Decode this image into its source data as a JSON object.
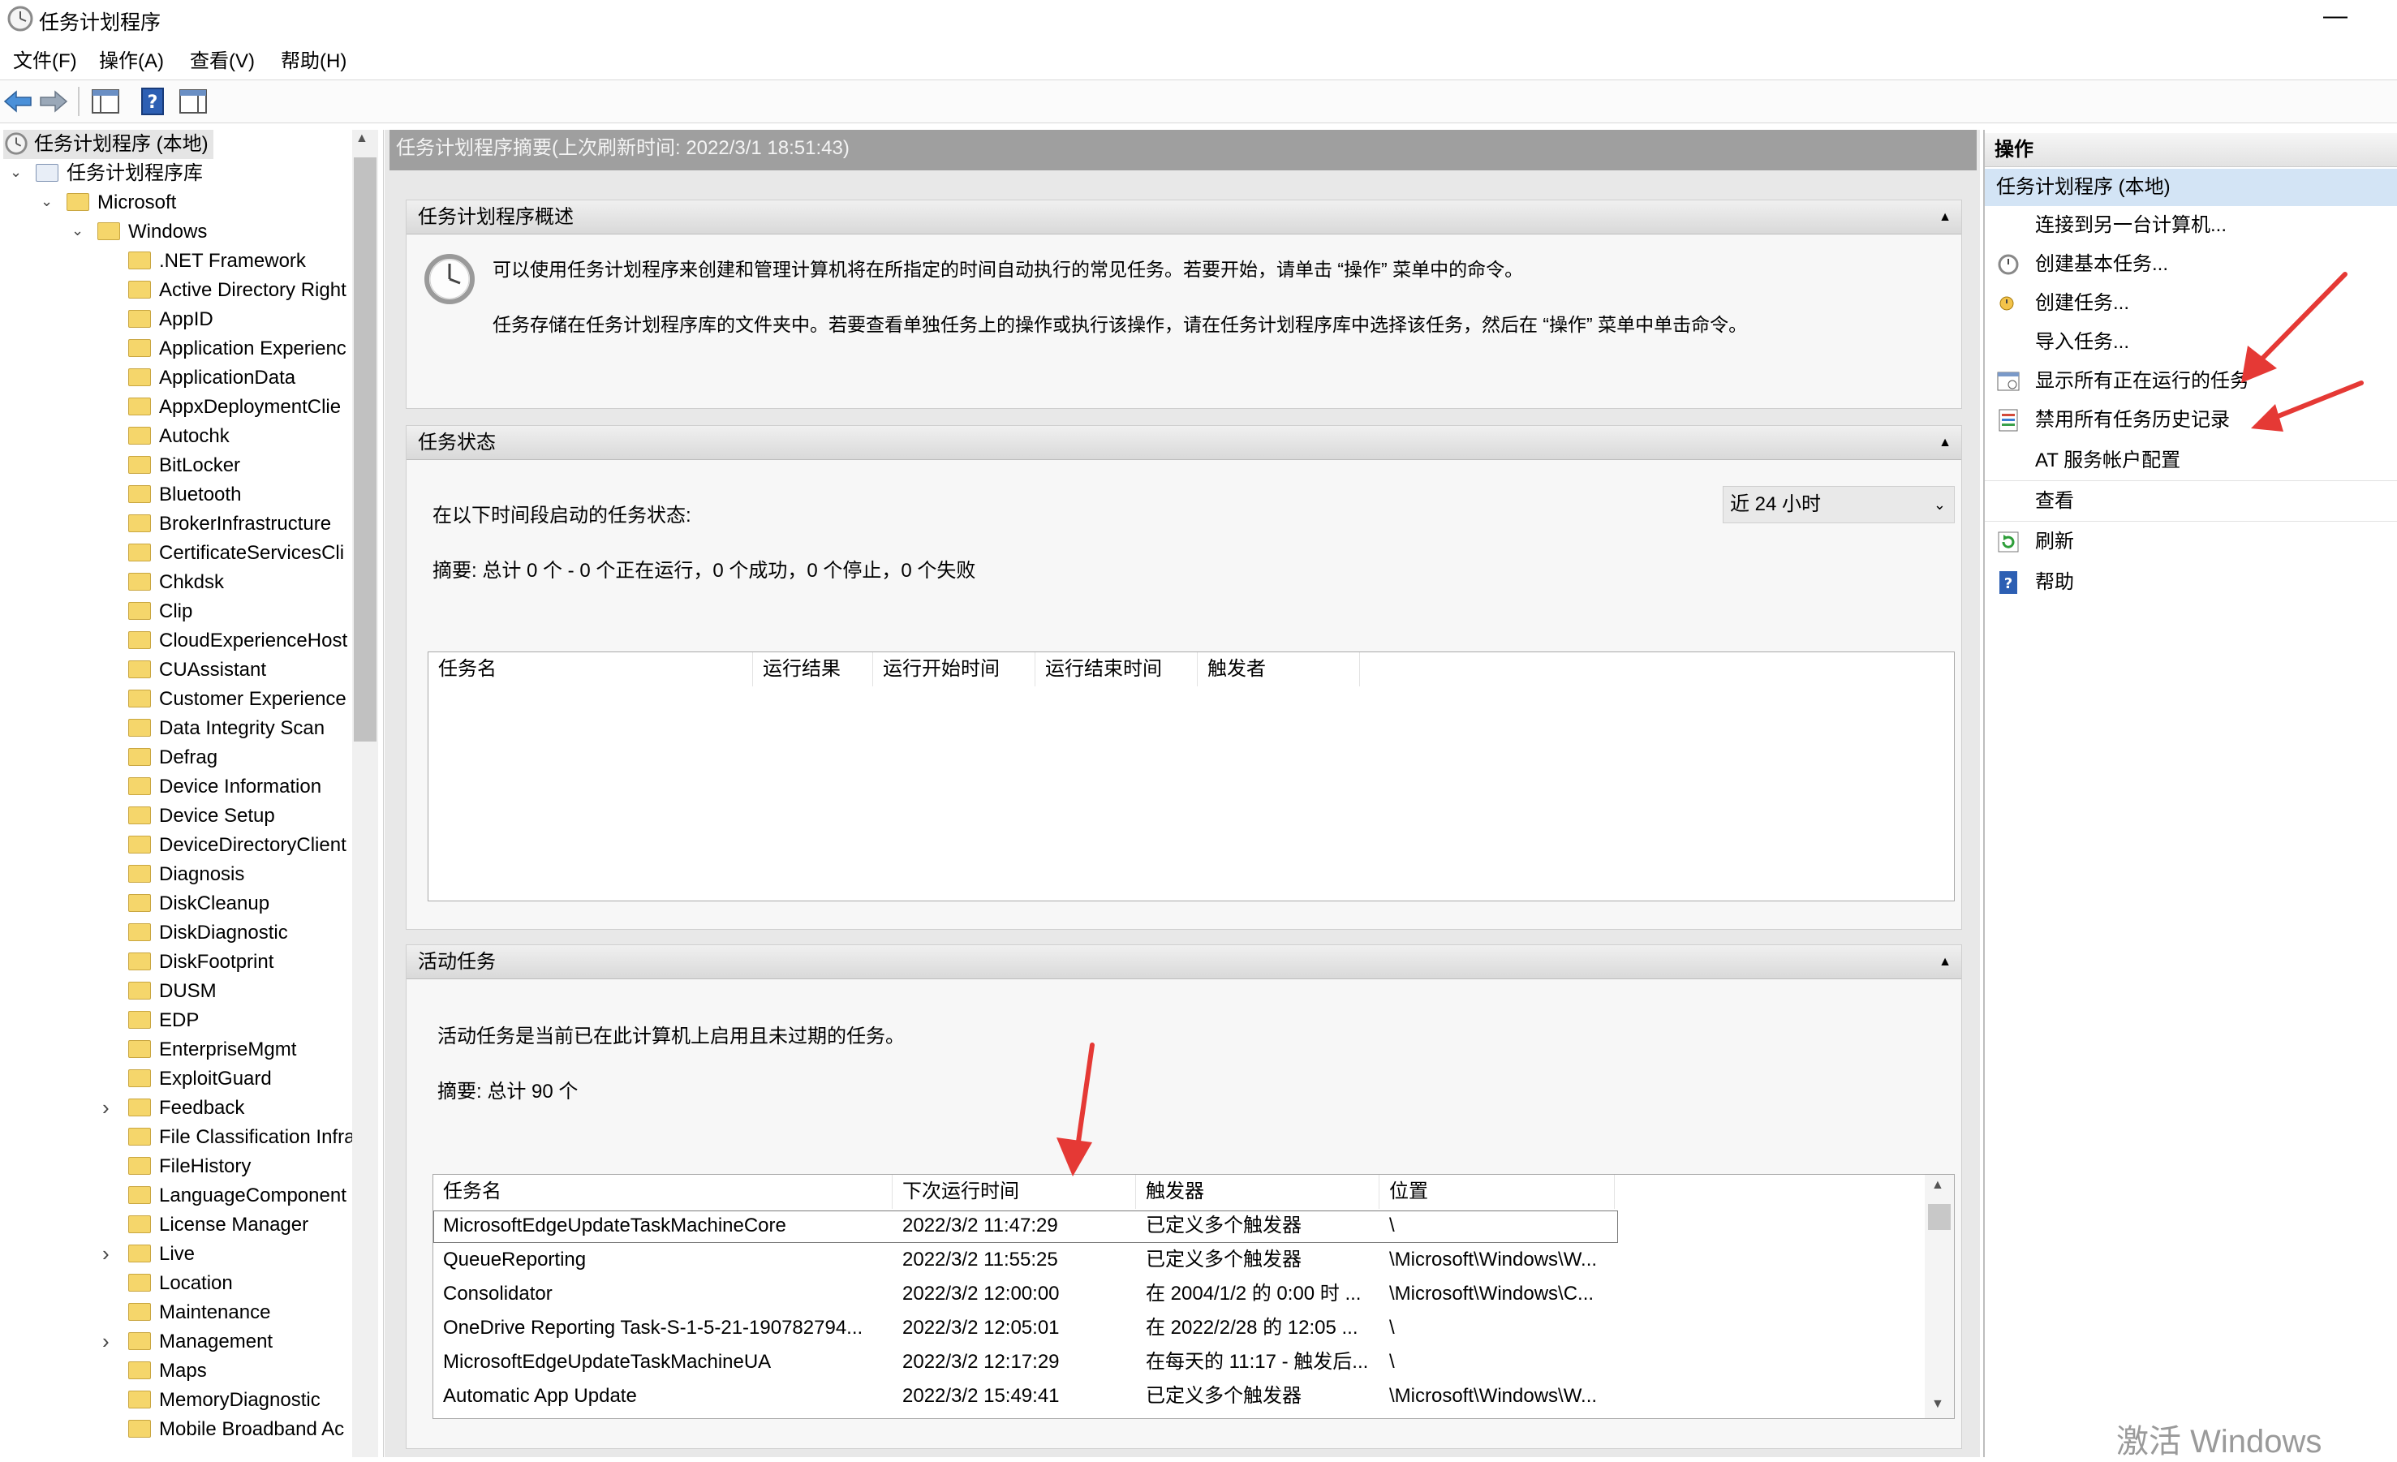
{
  "window": {
    "title": "任务计划程序"
  },
  "menu": [
    "文件(F)",
    "操作(A)",
    "查看(V)",
    "帮助(H)"
  ],
  "tree": {
    "root": "任务计划程序 (本地)",
    "library": "任务计划程序库",
    "microsoft": "Microsoft",
    "windows": "Windows",
    "folders": [
      ".NET Framework",
      "Active Directory Right",
      "AppID",
      "Application Experienc",
      "ApplicationData",
      "AppxDeploymentClie",
      "Autochk",
      "BitLocker",
      "Bluetooth",
      "BrokerInfrastructure",
      "CertificateServicesCli",
      "Chkdsk",
      "Clip",
      "CloudExperienceHost",
      "CUAssistant",
      "Customer Experience",
      "Data Integrity Scan",
      "Defrag",
      "Device Information",
      "Device Setup",
      "DeviceDirectoryClient",
      "Diagnosis",
      "DiskCleanup",
      "DiskDiagnostic",
      "DiskFootprint",
      "DUSM",
      "EDP",
      "EnterpriseMgmt",
      "ExploitGuard",
      "Feedback",
      "File Classification Infra",
      "FileHistory",
      "LanguageComponent",
      "License Manager",
      "Live",
      "Location",
      "Maintenance",
      "Management",
      "Maps",
      "MemoryDiagnostic",
      "Mobile Broadband Ac"
    ]
  },
  "center": {
    "header": "任务计划程序摘要(上次刷新时间: 2022/3/1 18:51:43)",
    "overview": {
      "title": "任务计划程序概述",
      "line1": "可以使用任务计划程序来创建和管理计算机将在所指定的时间自动执行的常见任务。若要开始，请单击 “操作” 菜单中的命令。",
      "line2": "任务存储在任务计划程序库的文件夹中。若要查看单独任务上的操作或执行该操作，请在任务计划程序库中选择该任务，然后在 “操作” 菜单中单击命令。"
    },
    "status": {
      "title": "任务状态",
      "label": "在以下时间段启动的任务状态:",
      "period": "近 24 小时",
      "summary": "摘要: 总计 0 个 - 0 个正在运行，0 个成功，0 个停止，0 个失败",
      "columns": [
        "任务名",
        "运行结果",
        "运行开始时间",
        "运行结束时间",
        "触发者"
      ]
    },
    "active": {
      "title": "活动任务",
      "desc": "活动任务是当前已在此计算机上启用且未过期的任务。",
      "summary": "摘要: 总计 90 个",
      "columns": [
        "任务名",
        "下次运行时间",
        "触发器",
        "位置"
      ],
      "rows": [
        [
          "MicrosoftEdgeUpdateTaskMachineCore",
          "2022/3/2 11:47:29",
          "已定义多个触发器",
          "\\"
        ],
        [
          "QueueReporting",
          "2022/3/2 11:55:25",
          "已定义多个触发器",
          "\\Microsoft\\Windows\\W..."
        ],
        [
          "Consolidator",
          "2022/3/2 12:00:00",
          "在 2004/1/2 的 0:00 时 ...",
          "\\Microsoft\\Windows\\C..."
        ],
        [
          "OneDrive Reporting Task-S-1-5-21-190782794...",
          "2022/3/2 12:05:01",
          "在 2022/2/28 的 12:05 ...",
          "\\"
        ],
        [
          "MicrosoftEdgeUpdateTaskMachineUA",
          "2022/3/2 12:17:29",
          "在每天的 11:17 - 触发后...",
          "\\"
        ],
        [
          "Automatic App Update",
          "2022/3/2 15:49:41",
          "已定义多个触发器",
          "\\Microsoft\\Windows\\W..."
        ]
      ]
    }
  },
  "actions": {
    "title": "操作",
    "group": "任务计划程序 (本地)",
    "items": [
      "连接到另一台计算机...",
      "创建基本任务...",
      "创建任务...",
      "导入任务...",
      "显示所有正在运行的任务",
      "禁用所有任务历史记录",
      "AT 服务帐户配置",
      "查看",
      "刷新",
      "帮助"
    ]
  },
  "watermark": "激活 Windows",
  "colors": {
    "arrow": "#e53935",
    "header_gray": "#9f9f9f",
    "selection": "#cce4f7"
  }
}
